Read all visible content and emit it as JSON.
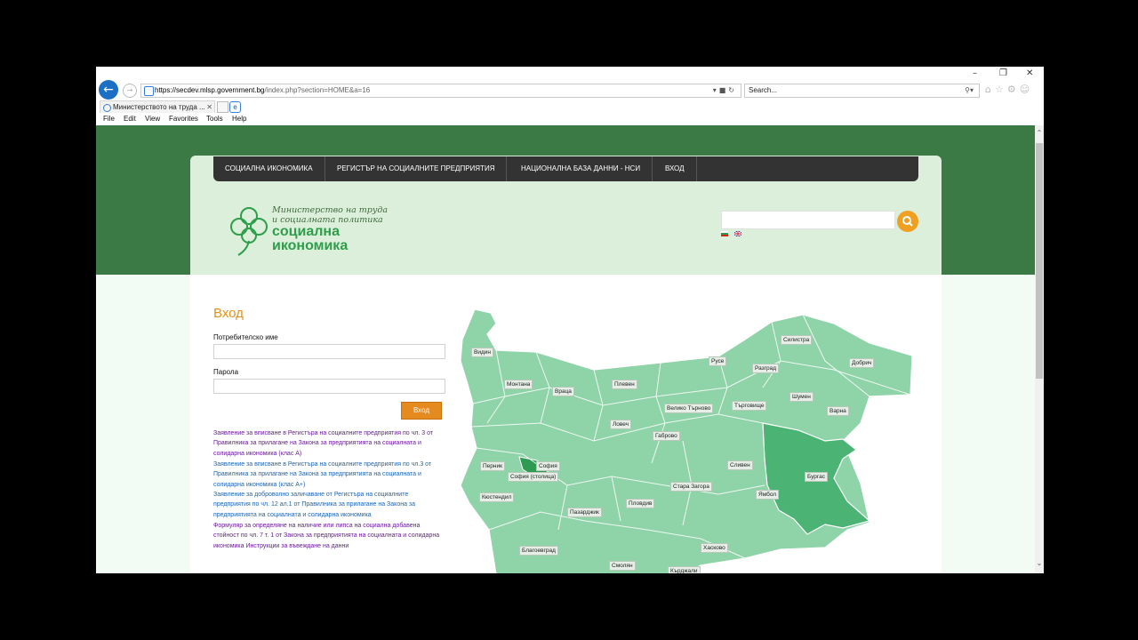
{
  "browser": {
    "url_domain": "https://secdev.mlsp.government.bg",
    "url_path": "/index.php?section=HOME&a=16",
    "search_placeholder": "Search...",
    "tab_title": "Министерството на труда ...",
    "menu": [
      "File",
      "Edit",
      "View",
      "Favorites",
      "Tools",
      "Help"
    ]
  },
  "site": {
    "nav": [
      "СОЦИАЛНА ИКОНОМИКА",
      "РЕГИСТЪР НА СОЦИАЛНИТЕ ПРЕДПРИЯТИЯ",
      "НАЦИОНАЛНА БАЗА ДАННИ - НСИ",
      "ВХОД"
    ],
    "logo": {
      "line1": "Министерство на труда",
      "line2": "и социалната политика",
      "name1": "социална",
      "name2": "икономика"
    }
  },
  "login": {
    "title": "Вход",
    "username_label": "Потребителско име",
    "password_label": "Парола",
    "submit": "Вход"
  },
  "links": [
    "Заявление за вписване в Регистъра на социалните предприятия по чл. 3 от Правилника за прилагане на Закона за предприятията на социалната и солидарна икономика (клас А)",
    "Заявление за вписване в Регистъра на социалните предприятия по чл.3 от Правилника за прилагане на Закона за предприятията на социалната и солидарна икономика (клас А+)",
    "Заявление за доброволно заличаване от Регистъра на социалните предприятия по чл. 12 ал.1 от Правилника за прилагане на Закона за предприятията на социалната и солидарна икономика",
    "Формуляр за определяне на наличие или липса на социална добавена стойност по чл. 7 т. 1 от Закона за предприятията на социалната и солидарна икономика Инструкции за въвеждане на данни"
  ],
  "colors": {
    "link_visited": "#6a1b9a",
    "link": "#1e63b0",
    "accent": "#e39217",
    "band": "#3b7a44"
  },
  "map_regions": [
    "Видин",
    "Монтана",
    "Враца",
    "Плевен",
    "Русе",
    "Разград",
    "Силистра",
    "Добрич",
    "Велико Търново",
    "Търговище",
    "Шумен",
    "Варна",
    "Ловеч",
    "Габрово",
    "Перник",
    "София",
    "София (столица)",
    "Кюстендил",
    "Сливен",
    "Бургас",
    "Стара Загора",
    "Ямбол",
    "Пазарджик",
    "Пловдив",
    "Благоевград",
    "Хасково",
    "Смолян",
    "Кърджали"
  ]
}
